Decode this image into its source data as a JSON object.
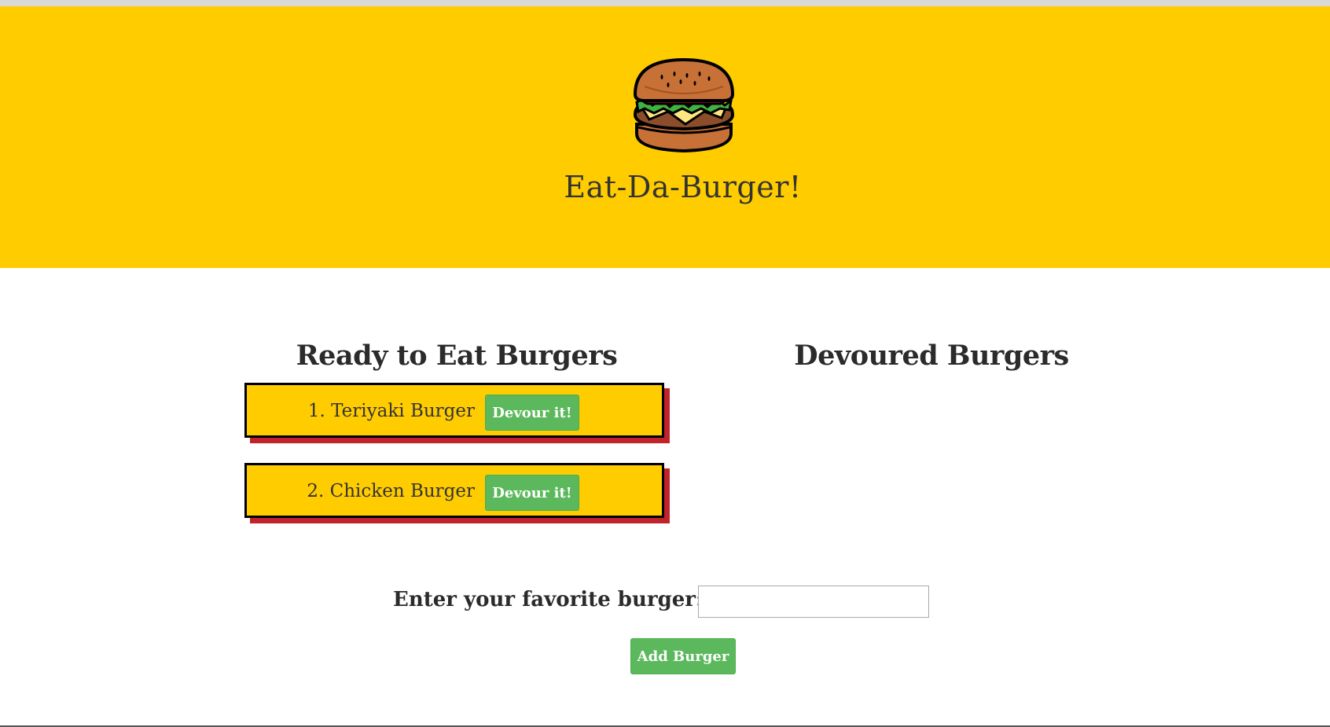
{
  "header": {
    "title": "Eat-Da-Burger!",
    "logo_icon": "burger-icon",
    "background_color": "#ffcc00"
  },
  "ready": {
    "heading": "Ready to Eat Burgers",
    "burgers": [
      {
        "label": "1. Teriyaki Burger",
        "button": "Devour it!"
      },
      {
        "label": "2. Chicken Burger",
        "button": "Devour it!"
      }
    ]
  },
  "devoured": {
    "heading": "Devoured Burgers",
    "burgers": []
  },
  "form": {
    "label": "Enter your favorite burger:",
    "input_value": "",
    "submit_label": "Add Burger"
  },
  "colors": {
    "accent": "#ffcc00",
    "button": "#5cb85c",
    "card_shadow": "#c0232b"
  }
}
